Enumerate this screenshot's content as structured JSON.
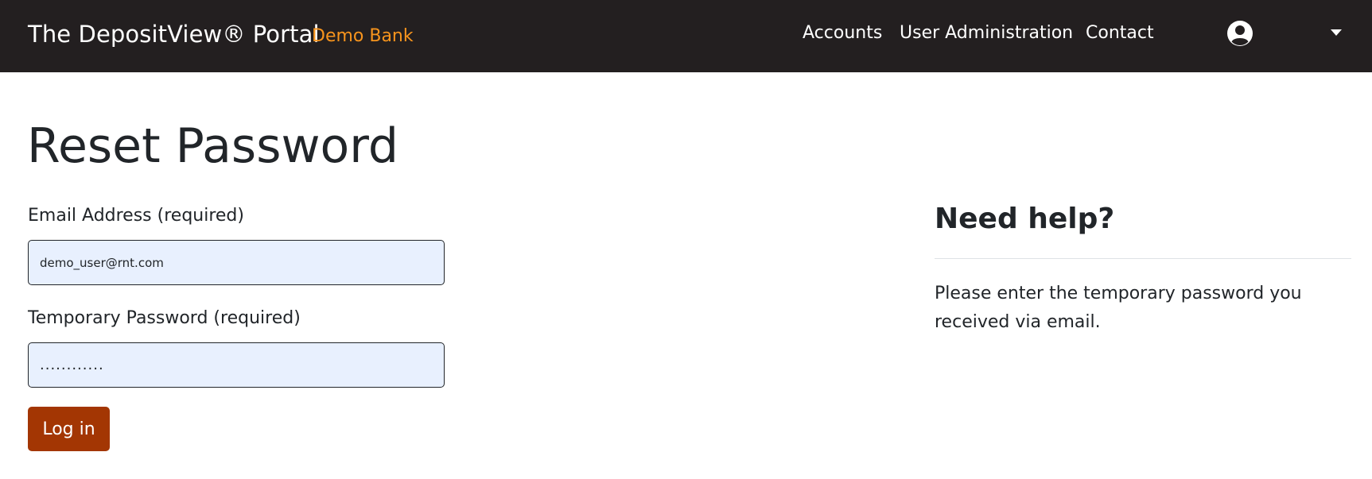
{
  "navbar": {
    "brand": "The DepositView® Portal",
    "bank": "Demo Bank",
    "links": [
      {
        "label": "Accounts"
      },
      {
        "label": "User Administration"
      },
      {
        "label": "Contact"
      }
    ],
    "user_icon": "user-circle-icon",
    "caret_icon": "chevron-down-icon"
  },
  "form": {
    "title": "Reset Password",
    "email_label": "Email Address (required)",
    "email_value": "demo_user@rnt.com",
    "temp_password_label": "Temporary Password (required)",
    "temp_password_value": "............",
    "login_button": "Log in"
  },
  "help": {
    "heading": "Need help?",
    "text": "Please enter the temporary password you received via email."
  },
  "colors": {
    "navbar_bg": "#231f20",
    "bank_accent": "#f7941d",
    "button_bg": "#a33603",
    "input_bg": "#e8f0fe"
  }
}
